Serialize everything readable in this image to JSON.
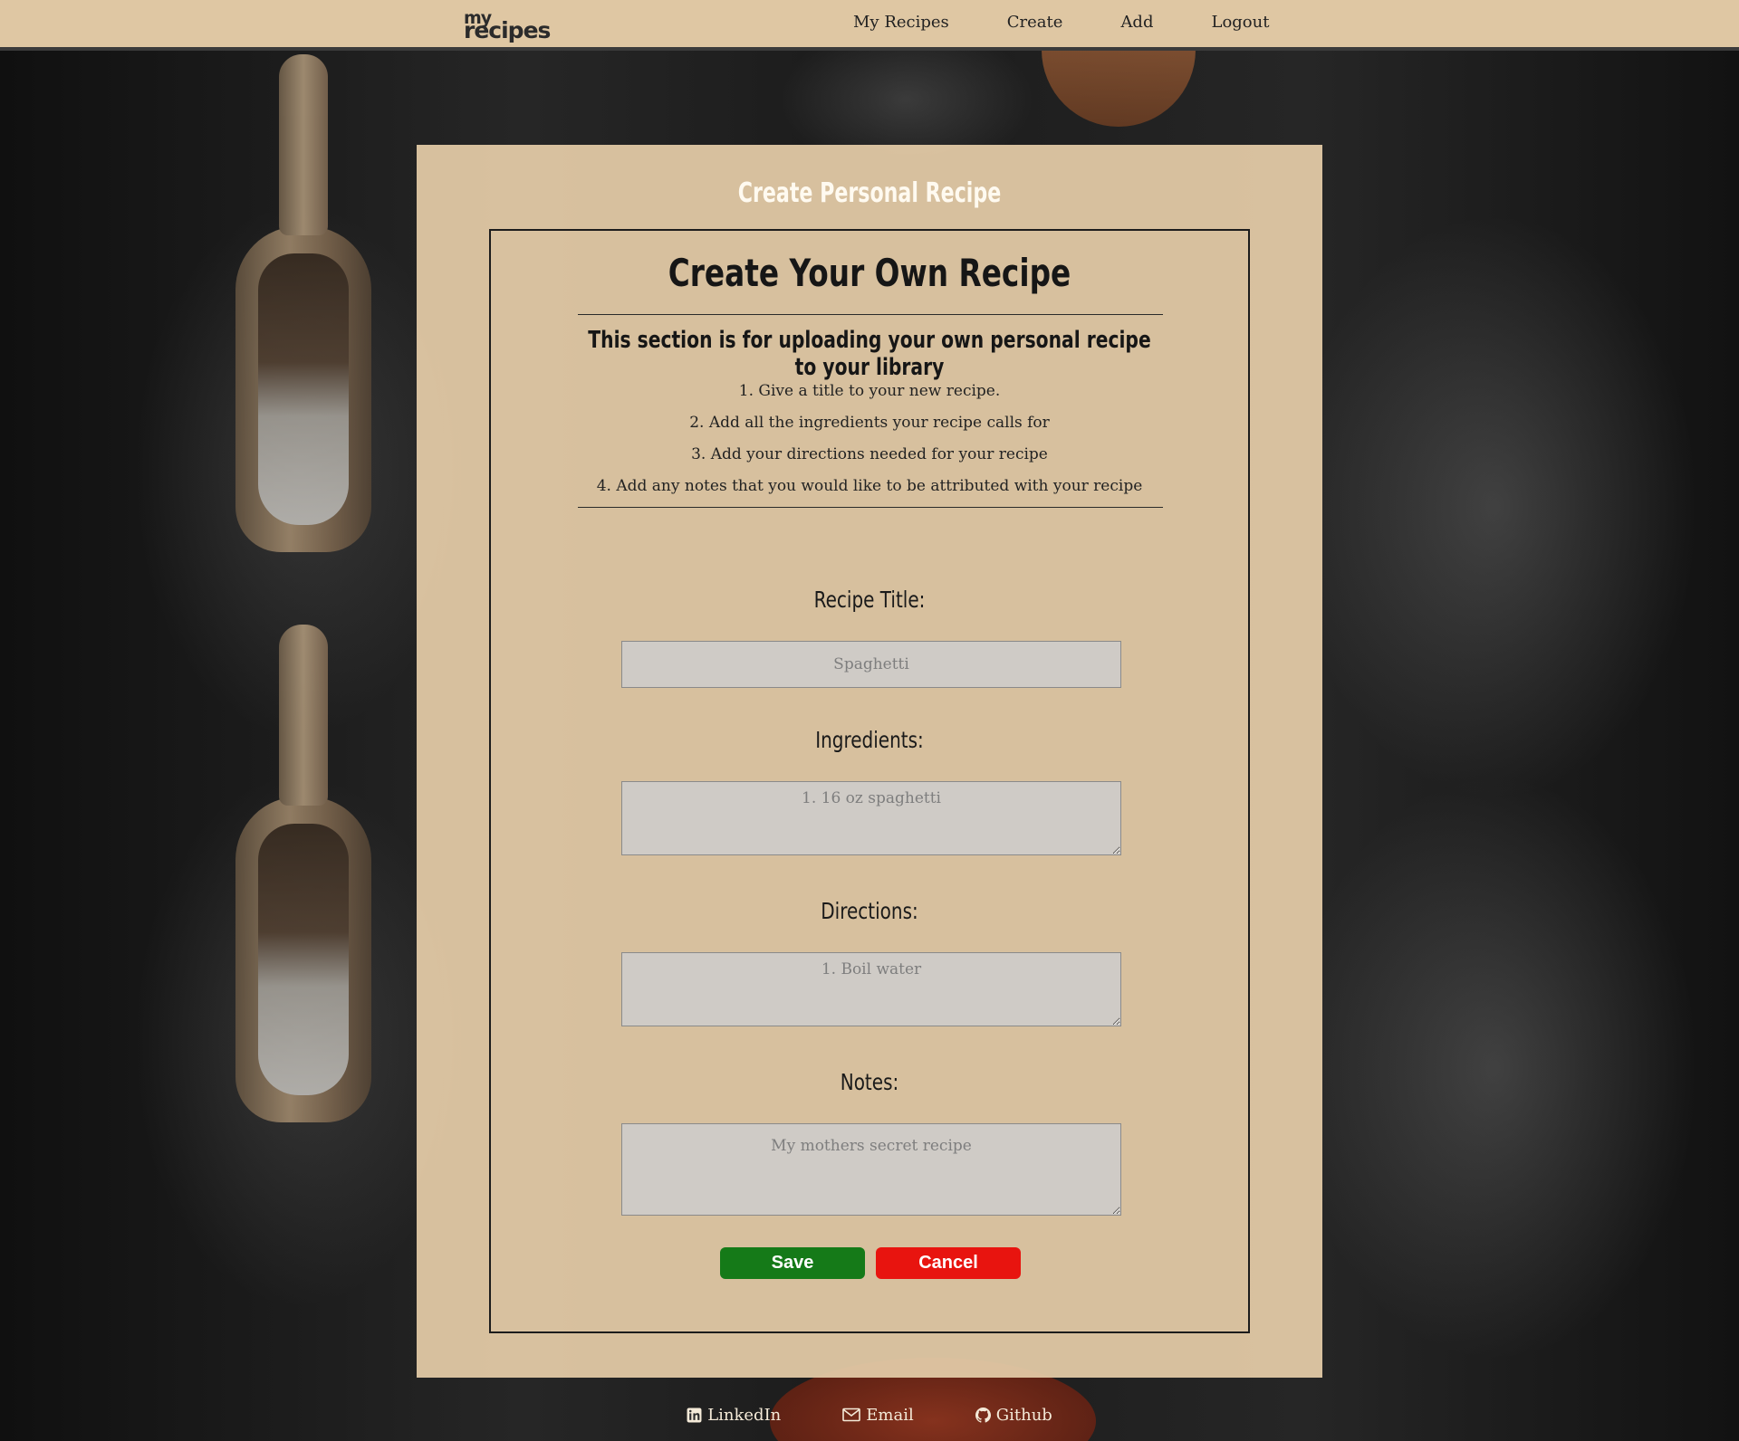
{
  "nav": {
    "logo_line1": "my",
    "logo_line2": "recipes",
    "links": [
      "My Recipes",
      "Create",
      "Add",
      "Logout"
    ]
  },
  "panel": {
    "title": "Create Personal Recipe",
    "heading": "Create Your Own Recipe",
    "subheading": "This section is for uploading your own personal recipe to your library",
    "steps": [
      "1. Give a title to your new recipe.",
      "2. Add all the ingredients your recipe calls for",
      "3. Add your directions needed for your recipe",
      "4. Add any notes that you would like to be attributed with your recipe"
    ]
  },
  "form": {
    "title_label": "Recipe Title:",
    "title_placeholder": "Spaghetti",
    "ingredients_label": "Ingredients:",
    "ingredients_placeholder": "1. 16 oz spaghetti",
    "directions_label": "Directions:",
    "directions_placeholder": "1. Boil water",
    "notes_label": "Notes:",
    "notes_placeholder": "My mothers secret recipe",
    "save_label": "Save",
    "cancel_label": "Cancel"
  },
  "footer": {
    "linkedin": "LinkedIn",
    "email": "Email",
    "github": "Github"
  },
  "colors": {
    "nav_bg": "#dfc7a3",
    "panel_bg": "#e1c9a5",
    "save": "#157a18",
    "cancel": "#e8140f"
  },
  "icons": [
    "linkedin-icon",
    "mail-icon",
    "github-icon"
  ]
}
